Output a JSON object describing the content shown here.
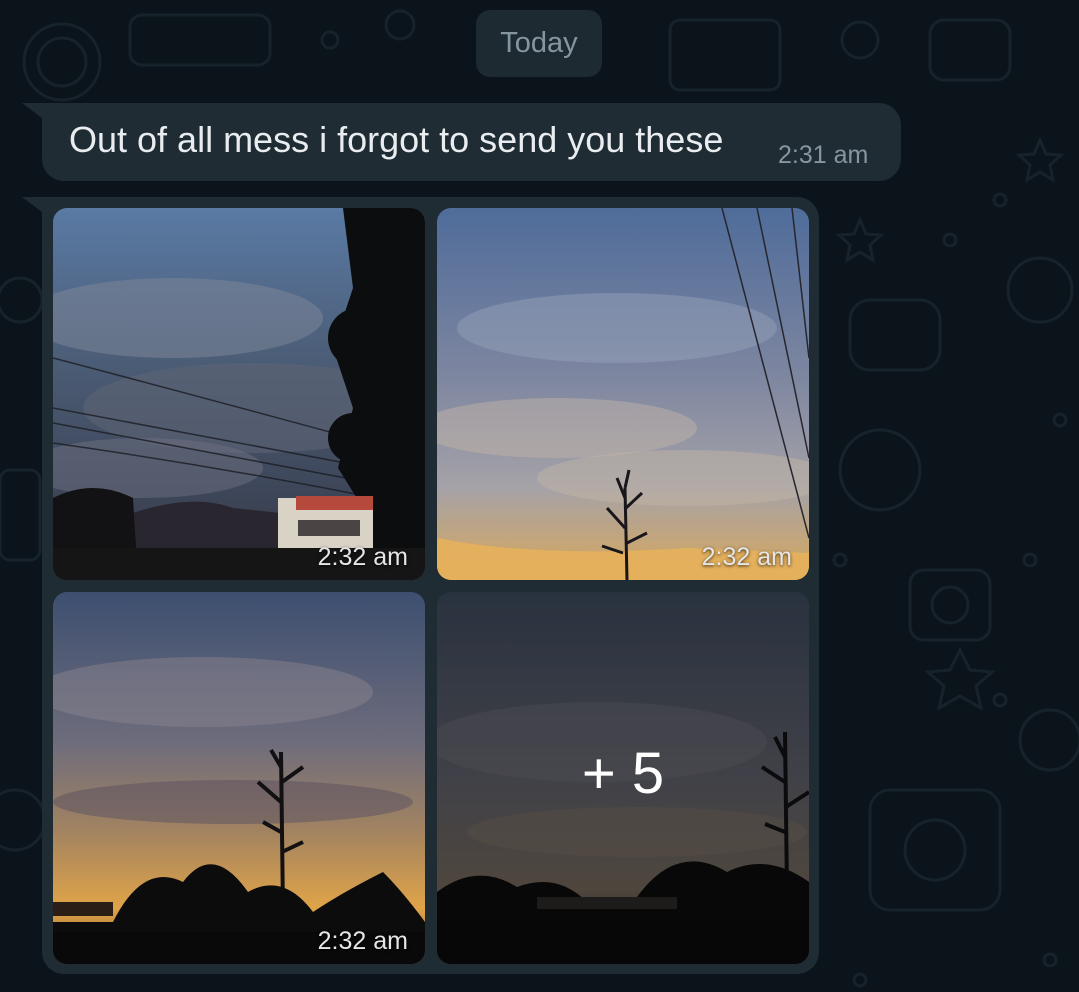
{
  "chat": {
    "date_label": "Today",
    "messages": [
      {
        "type": "text",
        "text": "Out of all mess i forgot to send you these",
        "time": "2:31 am"
      },
      {
        "type": "album",
        "photos": [
          {
            "time": "2:32 am"
          },
          {
            "time": "2:32 am"
          },
          {
            "time": "2:32 am"
          },
          {
            "more_label": "+ 5"
          }
        ]
      }
    ]
  },
  "colors": {
    "background": "#0b141a",
    "incoming_bubble": "#1f2c34",
    "date_pill": "#1d2a31",
    "primary_text": "#e9edef",
    "secondary_text": "#8696a0"
  }
}
